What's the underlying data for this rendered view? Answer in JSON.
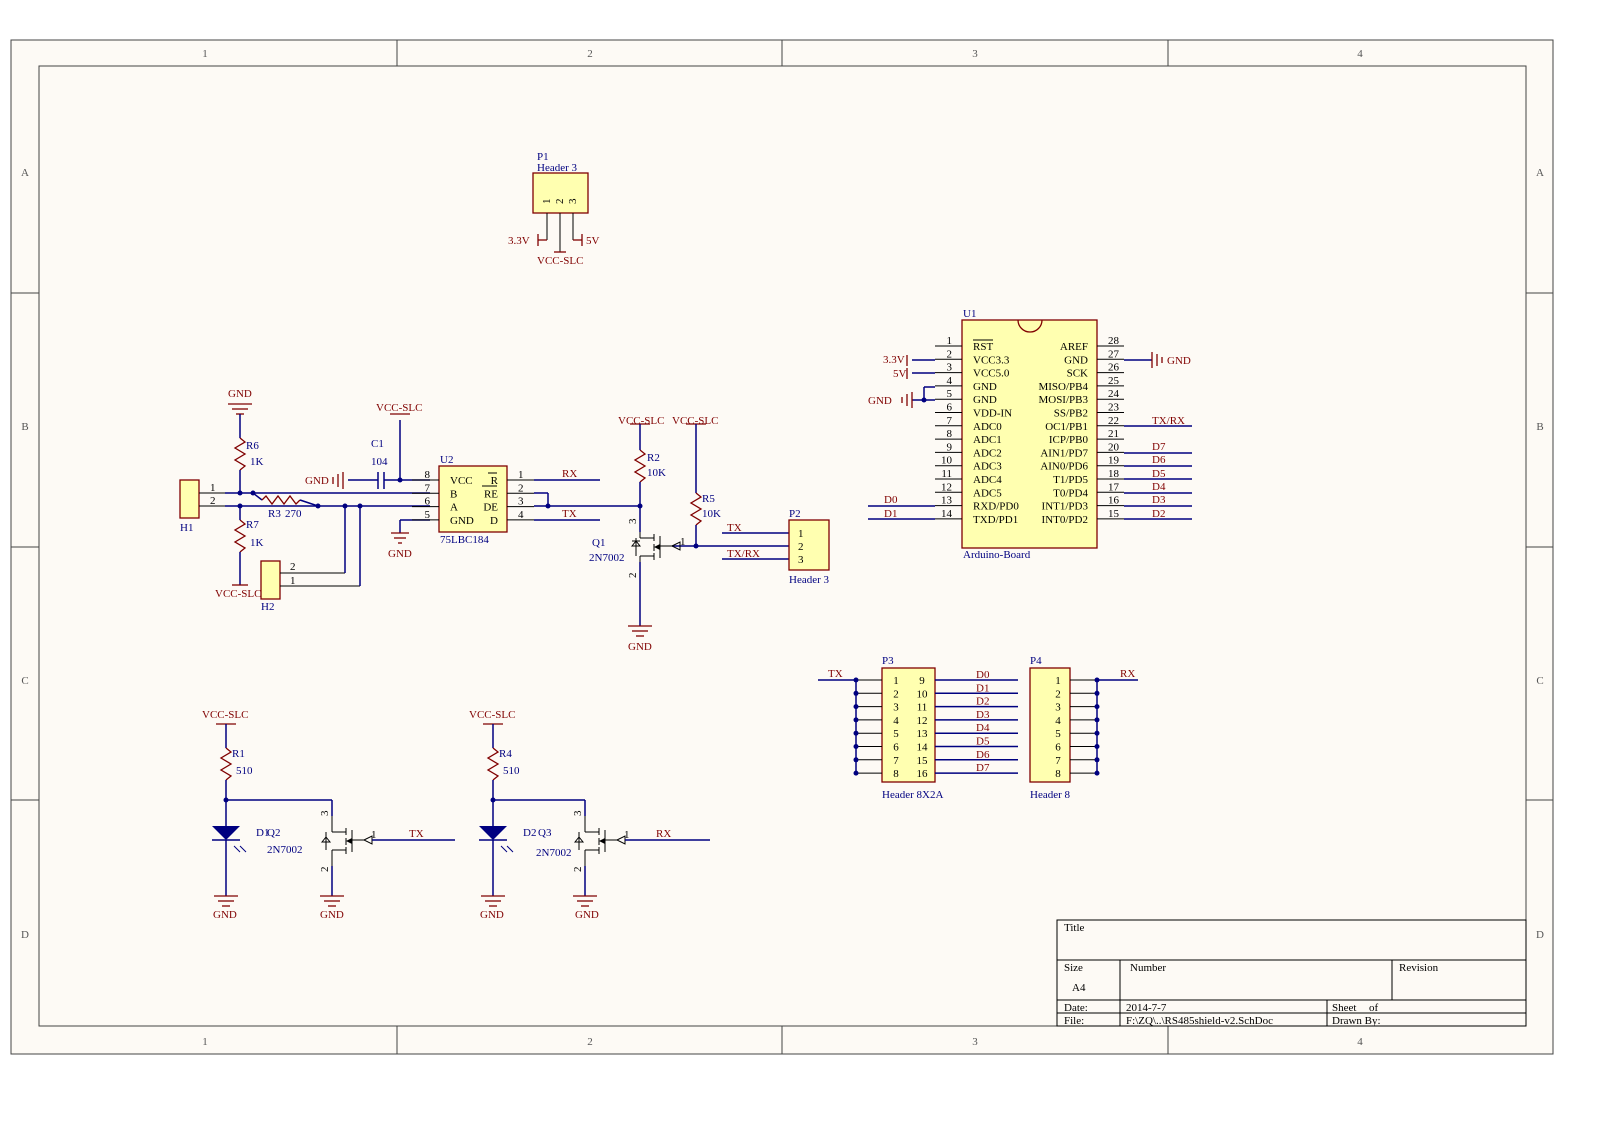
{
  "frame": {
    "cols": [
      "1",
      "2",
      "3",
      "4"
    ],
    "rows": [
      "A",
      "B",
      "C",
      "D"
    ]
  },
  "colors": {
    "wire": "#000080",
    "power": "#800000",
    "chip_fill": "#ffffb0",
    "paper": "#fdfaf5"
  },
  "power": {
    "gnd": "GND",
    "vcc_slc": "VCC-SLC",
    "v33": "3.3V",
    "v5": "5V"
  },
  "nets": {
    "rx": "RX",
    "tx": "TX",
    "txrx": "TX/RX",
    "d0": "D0",
    "d1": "D1",
    "d2": "D2",
    "d3": "D3",
    "d4": "D4",
    "d5": "D5",
    "d6": "D6",
    "d7": "D7"
  },
  "p1": {
    "ref": "P1",
    "name": "Header 3",
    "pins": [
      "1",
      "2",
      "3"
    ]
  },
  "u1": {
    "ref": "U1",
    "name": "Arduino-Board",
    "left": [
      {
        "n": "1",
        "f": "RST"
      },
      {
        "n": "2",
        "f": "VCC3.3"
      },
      {
        "n": "3",
        "f": "VCC5.0"
      },
      {
        "n": "4",
        "f": "GND"
      },
      {
        "n": "5",
        "f": "GND"
      },
      {
        "n": "6",
        "f": "VDD-IN"
      },
      {
        "n": "7",
        "f": "ADC0"
      },
      {
        "n": "8",
        "f": "ADC1"
      },
      {
        "n": "9",
        "f": "ADC2"
      },
      {
        "n": "10",
        "f": "ADC3"
      },
      {
        "n": "11",
        "f": "ADC4"
      },
      {
        "n": "12",
        "f": "ADC5"
      },
      {
        "n": "13",
        "f": "RXD/PD0"
      },
      {
        "n": "14",
        "f": "TXD/PD1"
      }
    ],
    "right": [
      {
        "n": "28",
        "f": "AREF"
      },
      {
        "n": "27",
        "f": "GND"
      },
      {
        "n": "26",
        "f": "SCK"
      },
      {
        "n": "25",
        "f": "MISO/PB4"
      },
      {
        "n": "24",
        "f": "MOSI/PB3"
      },
      {
        "n": "23",
        "f": "SS/PB2"
      },
      {
        "n": "22",
        "f": "OC1/PB1"
      },
      {
        "n": "21",
        "f": "ICP/PB0"
      },
      {
        "n": "20",
        "f": "AIN1/PD7"
      },
      {
        "n": "19",
        "f": "AIN0/PD6"
      },
      {
        "n": "18",
        "f": "T1/PD5"
      },
      {
        "n": "17",
        "f": "T0/PD4"
      },
      {
        "n": "16",
        "f": "INT1/PD3"
      },
      {
        "n": "15",
        "f": "INT0/PD2"
      }
    ]
  },
  "u2": {
    "ref": "U2",
    "name": "75LBC184",
    "left": [
      {
        "n": "8",
        "f": "VCC"
      },
      {
        "n": "7",
        "f": "B"
      },
      {
        "n": "6",
        "f": "A"
      },
      {
        "n": "5",
        "f": "GND"
      }
    ],
    "right": [
      {
        "n": "1",
        "f": "R"
      },
      {
        "n": "2",
        "f": "RE"
      },
      {
        "n": "3",
        "f": "DE"
      },
      {
        "n": "4",
        "f": "D"
      }
    ]
  },
  "h1": {
    "ref": "H1",
    "pins": [
      "1",
      "2"
    ]
  },
  "h2": {
    "ref": "H2",
    "pins": [
      "2",
      "1"
    ]
  },
  "r6": {
    "ref": "R6",
    "val": "1K"
  },
  "r7": {
    "ref": "R7",
    "val": "1K"
  },
  "r3": {
    "ref": "R3",
    "val": "270"
  },
  "c1": {
    "ref": "C1",
    "val": "104"
  },
  "r2": {
    "ref": "R2",
    "val": "10K"
  },
  "r5": {
    "ref": "R5",
    "val": "10K"
  },
  "q1": {
    "ref": "Q1",
    "val": "2N7002",
    "pins": [
      "1",
      "2",
      "3"
    ]
  },
  "p2": {
    "ref": "P2",
    "name": "Header 3",
    "pins": [
      "1",
      "2",
      "3"
    ]
  },
  "r1": {
    "ref": "R1",
    "val": "510"
  },
  "r4": {
    "ref": "R4",
    "val": "510"
  },
  "d1": {
    "ref": "D1"
  },
  "d2": {
    "ref": "D2"
  },
  "q2": {
    "ref": "Q2",
    "val": "2N7002"
  },
  "q3": {
    "ref": "Q3",
    "val": "2N7002"
  },
  "p3": {
    "ref": "P3",
    "name": "Header 8X2A",
    "left": [
      "1",
      "2",
      "3",
      "4",
      "5",
      "6",
      "7",
      "8"
    ],
    "right": [
      "9",
      "10",
      "11",
      "12",
      "13",
      "14",
      "15",
      "16"
    ]
  },
  "p4": {
    "ref": "P4",
    "name": "Header 8",
    "pins": [
      "1",
      "2",
      "3",
      "4",
      "5",
      "6",
      "7",
      "8"
    ]
  },
  "title_block": {
    "title_label": "Title",
    "size_label": "Size",
    "size": "A4",
    "number_label": "Number",
    "revision_label": "Revision",
    "date_label": "Date:",
    "date": "2014-7-7",
    "sheet_label": "Sheet",
    "of_label": "of",
    "file_label": "File:",
    "file": "F:\\ZQ\\..\\RS485shield-v2.SchDoc",
    "drawn_label": "Drawn By:"
  }
}
